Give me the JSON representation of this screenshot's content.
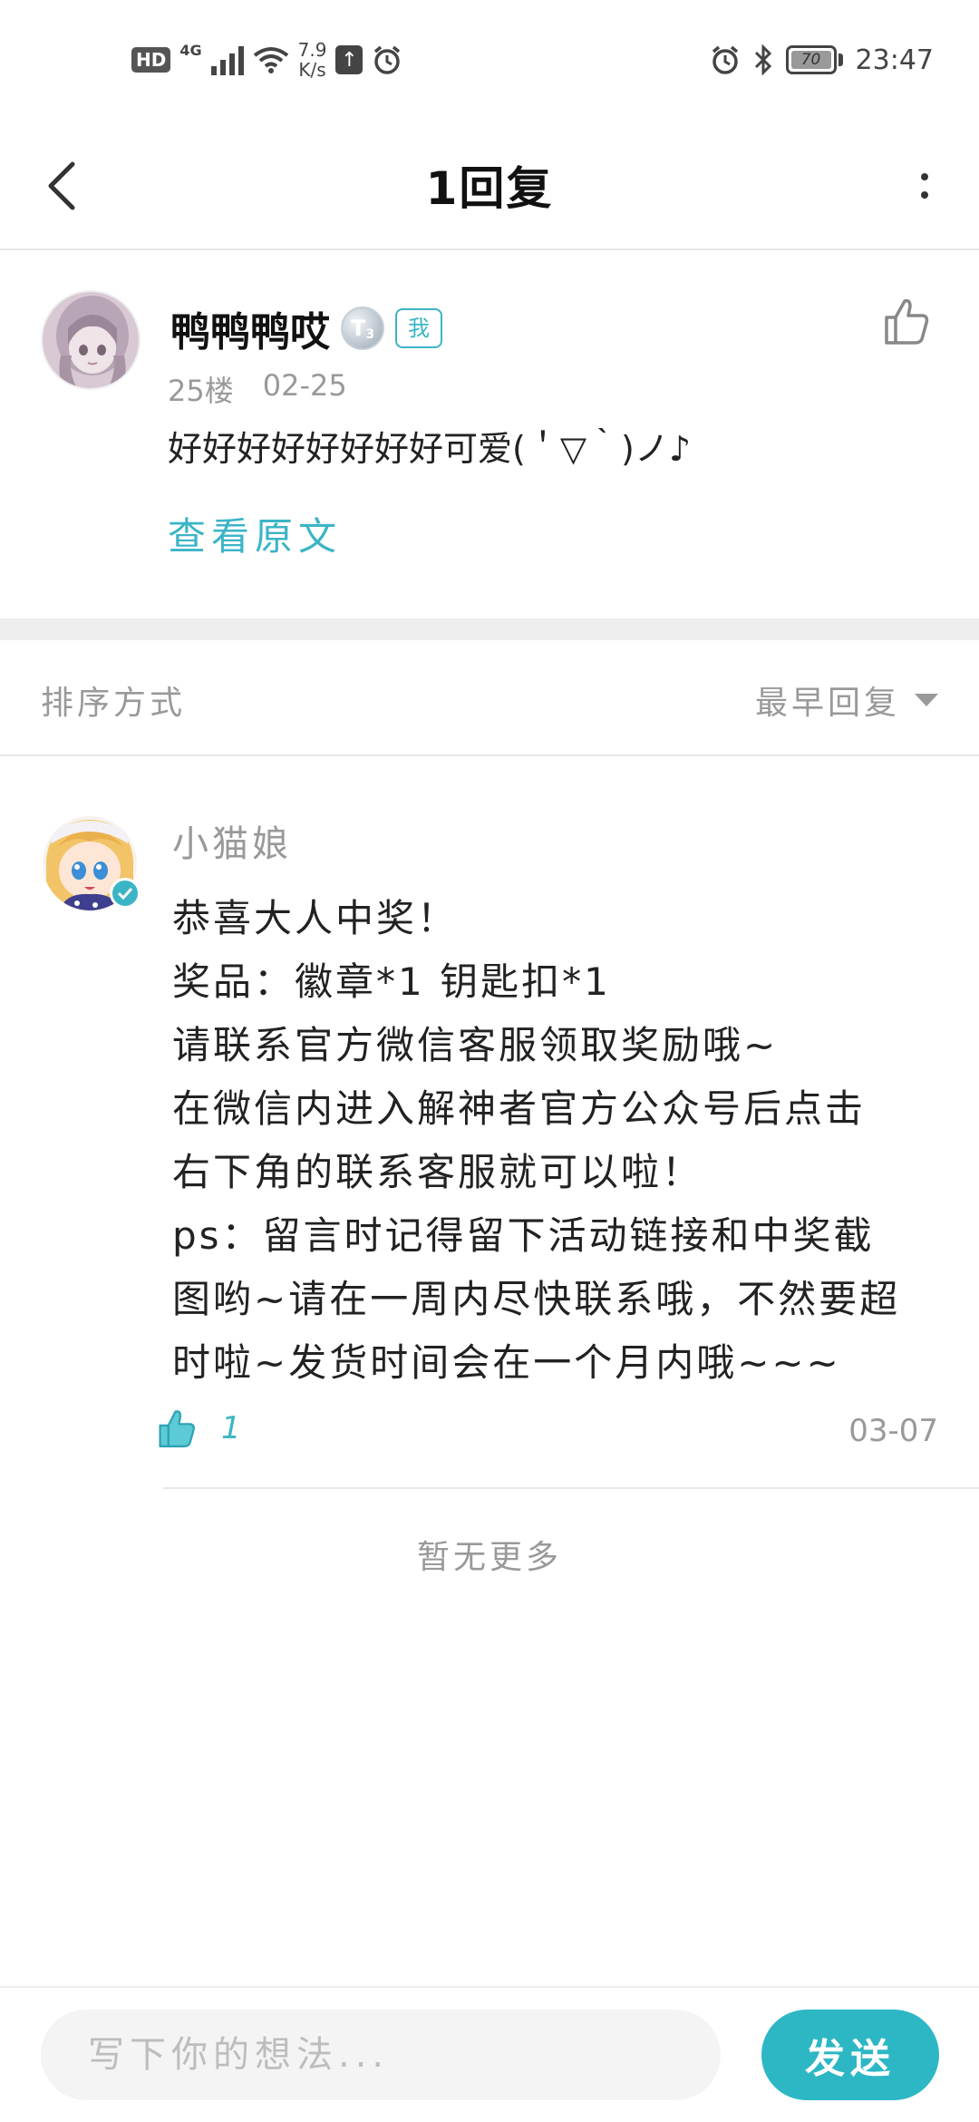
{
  "status_bar": {
    "hd": "HD",
    "network": "4G",
    "speed_value": "7.9",
    "speed_unit": "K/s",
    "battery": "70",
    "time": "23:47"
  },
  "header": {
    "title": "1回复",
    "back_icon": "chevron-left-icon",
    "more_icon": "vertical-dots-icon"
  },
  "post": {
    "author": "鸭鸭鸭哎",
    "level": "T",
    "level_sub": "3",
    "me_tag": "我",
    "floor": "25楼",
    "date": "02-25",
    "content": "好好好好好好好好可爱(＇▽｀)ノ♪",
    "view_original": "查看原文"
  },
  "sort": {
    "label": "排序方式",
    "selected": "最早回复"
  },
  "reply": {
    "author": "小猫娘",
    "lines": [
      "恭喜大人中奖！",
      "奖品：徽章*1 钥匙扣*1",
      "请联系官方微信客服领取奖励哦~",
      "在微信内进入解神者官方公众号后点击",
      "右下角的联系客服就可以啦！",
      "ps：留言时记得留下活动链接和中奖截",
      "图哟~请在一周内尽快联系哦，不然要超",
      "时啦~发货时间会在一个月内哦~~~"
    ],
    "likes": "1",
    "date": "03-07"
  },
  "no_more": "暂无更多",
  "bottom": {
    "placeholder": "写下你的想法...",
    "send_label": "发送"
  },
  "colors": {
    "accent": "#3bb5c6",
    "send_button": "#2db7c4",
    "muted_text": "#999999"
  }
}
